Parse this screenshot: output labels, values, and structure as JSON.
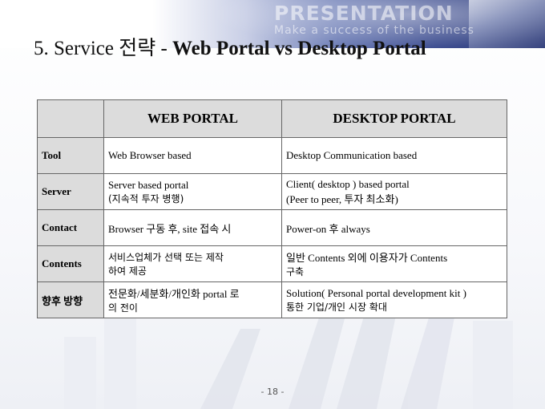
{
  "banner": {
    "word": "PRESENTATION",
    "tagline": "Make a success of the business"
  },
  "title": {
    "prefix": "5. Service 전략 - ",
    "emphasis": "Web Portal vs Desktop Portal"
  },
  "table": {
    "headers": [
      "",
      "WEB PORTAL",
      "DESKTOP PORTAL"
    ],
    "rows": [
      {
        "label": "Tool",
        "web": [
          "Web Browser based"
        ],
        "desktop": [
          "Desktop Communication based"
        ]
      },
      {
        "label": "Server",
        "web": [
          "Server based portal",
          "(지속적 투자 병행)"
        ],
        "desktop": [
          "Client( desktop ) based portal",
          "(Peer to peer, 투자 최소화)"
        ]
      },
      {
        "label": "Contact",
        "web": [
          "Browser 구동 후, site 접속 시"
        ],
        "desktop": [
          "Power-on 후 always"
        ]
      },
      {
        "label": "Contents",
        "web": [
          "서비스업체가 선택 또는 제작",
          "하여 제공"
        ],
        "desktop": [
          "일반 Contents 외에 이용자가 Contents",
          "구축"
        ]
      },
      {
        "label": "향후 방향",
        "web": [
          "전문화/세분화/개인화 portal 로",
          "의 전이"
        ],
        "desktop": [
          "Solution( Personal portal development kit )",
          "통한 기업/개인 시장 확대"
        ]
      }
    ]
  },
  "footer": {
    "page": "- 18 -"
  }
}
